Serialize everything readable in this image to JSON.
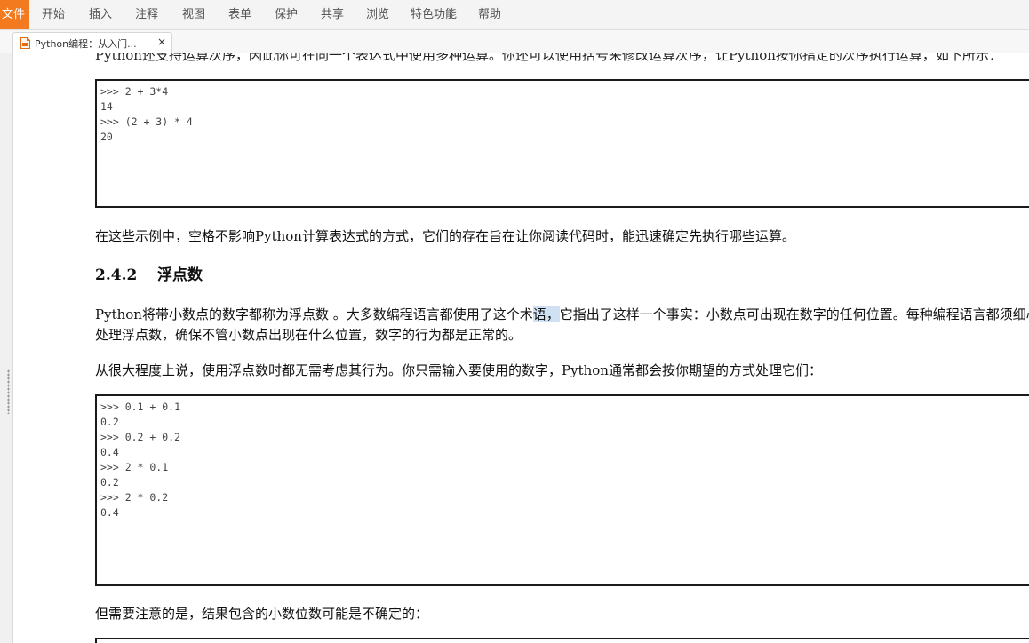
{
  "menubar": {
    "file_label": "文件",
    "items": [
      "开始",
      "插入",
      "注释",
      "视图",
      "表单",
      "保护",
      "共享",
      "浏览",
      "特色功能",
      "帮助"
    ]
  },
  "tab": {
    "title": "Python编程：从入门...",
    "close": "×"
  },
  "content": {
    "cut_line": "Python还支持运算次序，因此你可在同一个表达式中使用多种运算。你还可以使用括号来修改运算次序，让Python按你指定的次序执行运算，如下所示：",
    "code1": [
      ">>> 2 + 3*4",
      "14",
      ">>> (2 + 3) * 4",
      "20"
    ],
    "para1": "在这些示例中，空格不影响Python计算表达式的方式，它们的存在旨在让你阅读代码时，能迅速确定先执行哪些运算。",
    "heading_num": "2.4.2",
    "heading_title": "浮点数",
    "para2_a": "Python将带小数点的数字都称为浮点数 。大多数编程语言都使用了这个术",
    "para2_hl": "语，",
    "para2_b": "它指出了这样一个事实：小数点可出现在数字的任何位置。每种编程语言都须细心设计，以妥善地",
    "para2_line2": "处理浮点数，确保不管小数点出现在什么位置，数字的行为都是正常的。",
    "para3": "从很大程度上说，使用浮点数时都无需考虑其行为。你只需输入要使用的数字，Python通常都会按你期望的方式处理它们：",
    "code2": [
      ">>> 0.1 + 0.1",
      "0.2",
      ">>> 0.2 + 0.2",
      "0.4",
      ">>> 2 * 0.1",
      "0.2",
      ">>> 2 * 0.2",
      "0.4"
    ],
    "para4": "但需要注意的是，结果包含的小数位数可能是不确定的："
  },
  "colors": {
    "accent": "#f47a20",
    "highlight": "#cfe1f2"
  }
}
